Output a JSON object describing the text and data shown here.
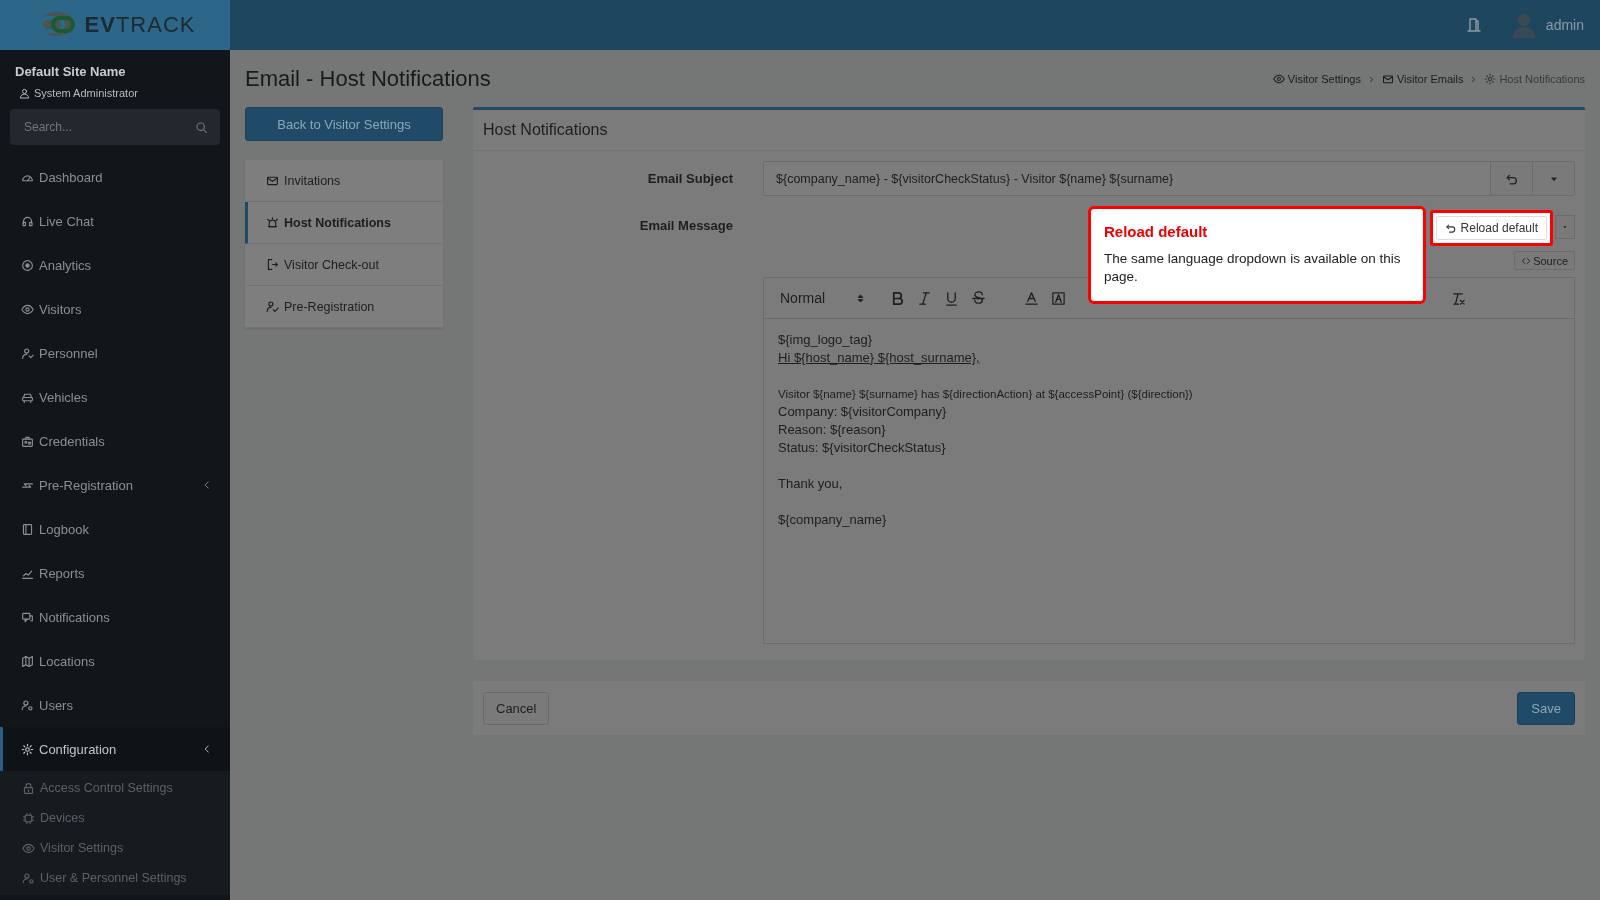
{
  "header": {
    "logo_text": "**EV**TRACK",
    "user": "admin"
  },
  "sidebar": {
    "site_name": "Default Site Name",
    "role": "System Administrator",
    "search": {
      "placeholder": "Search..."
    },
    "items": [
      {
        "label": "Dashboard",
        "selected": false,
        "expandable": false
      },
      {
        "label": "Live Chat",
        "selected": false,
        "expandable": false
      },
      {
        "label": "Analytics",
        "selected": false,
        "expandable": false
      },
      {
        "label": "Visitors",
        "selected": false,
        "expandable": false
      },
      {
        "label": "Personnel",
        "selected": false,
        "expandable": false
      },
      {
        "label": "Vehicles",
        "selected": false,
        "expandable": false
      },
      {
        "label": "Credentials",
        "selected": false,
        "expandable": false
      },
      {
        "label": "Pre-Registration",
        "selected": false,
        "expandable": true
      },
      {
        "label": "Logbook",
        "selected": false,
        "expandable": false
      },
      {
        "label": "Reports",
        "selected": false,
        "expandable": false
      },
      {
        "label": "Notifications",
        "selected": false,
        "expandable": false
      },
      {
        "label": "Locations",
        "selected": false,
        "expandable": false
      },
      {
        "label": "Users",
        "selected": false,
        "expandable": false
      },
      {
        "label": "Configuration",
        "selected": true,
        "expandable": true,
        "children": [
          {
            "label": "Access Control Settings"
          },
          {
            "label": "Devices"
          },
          {
            "label": "Visitor Settings"
          },
          {
            "label": "User & Personnel Settings"
          }
        ]
      }
    ]
  },
  "page": {
    "title": "Email - Host Notifications",
    "breadcrumbs": [
      {
        "label": "Visitor Settings"
      },
      {
        "label": "Visitor Emails"
      },
      {
        "label": "Host Notifications"
      }
    ]
  },
  "back_button": "Back to Visitor Settings",
  "email_tabs": [
    {
      "label": "Invitations",
      "selected": false
    },
    {
      "label": "Host Notifications",
      "selected": true
    },
    {
      "label": "Visitor Check-out",
      "selected": false
    },
    {
      "label": "Pre-Registration",
      "selected": false
    }
  ],
  "card": {
    "title": "Host Notifications",
    "subject": {
      "label": "Email Subject",
      "value": "${company_name} - ${visitorCheckStatus} - Visitor ${name} ${surname}"
    },
    "message": {
      "label": "Email Message",
      "reload_button": "Reload default",
      "source_button": "Source",
      "format_select": "Normal",
      "paragraphs": [
        {
          "lines": [
            {
              "text": "${img_logo_tag}",
              "underline": false,
              "small": false
            },
            {
              "text": "Hi ${host_name} ${host_surname},",
              "underline": true,
              "small": false
            }
          ]
        },
        {
          "lines": [
            {
              "text": "Visitor ${name} ${surname} has ${directionAction} at ${accessPoint} (${direction})",
              "underline": false,
              "small": true
            },
            {
              "text": "Company: ${visitorCompany}",
              "underline": false,
              "small": false
            },
            {
              "text": "Reason: ${reason}",
              "underline": false,
              "small": false
            },
            {
              "text": "Status: ${visitorCheckStatus}",
              "underline": false,
              "small": false
            }
          ]
        },
        {
          "lines": [
            {
              "text": "Thank you,",
              "underline": false,
              "small": false
            }
          ]
        },
        {
          "lines": [
            {
              "text": "${company_name}",
              "underline": false,
              "small": false
            }
          ]
        }
      ]
    }
  },
  "tooltip": {
    "title": "Reload default",
    "text": "The same language dropdown is available on this page."
  },
  "footer": {
    "cancel": "Cancel",
    "save": "Save"
  }
}
